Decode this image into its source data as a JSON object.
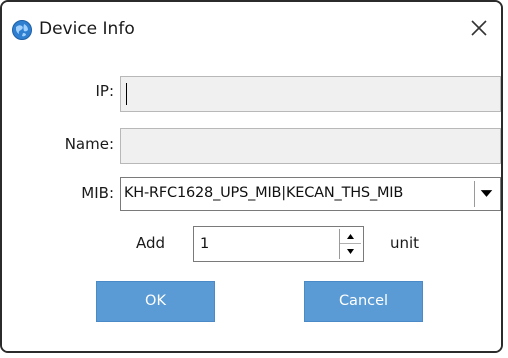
{
  "window": {
    "title": "Device Info",
    "app_icon": "app-globe-icon",
    "close_icon": "close-icon"
  },
  "form": {
    "ip": {
      "label": "IP:",
      "value": ""
    },
    "name": {
      "label": "Name:",
      "value": ""
    },
    "mib": {
      "label": "MIB:",
      "selected": "KH-RFC1628_UPS_MIB|KECAN_THS_MIB",
      "dropdown_icon": "triangle-down-icon"
    },
    "add": {
      "label": "Add",
      "value": "1",
      "unit_label": "unit",
      "up_icon": "spin-up-icon",
      "down_icon": "spin-down-icon"
    }
  },
  "buttons": {
    "ok": "OK",
    "cancel": "Cancel"
  },
  "colors": {
    "button_bg": "#5b9bd5",
    "field_bg": "#f0f0f0",
    "window_border": "#2b2b2b"
  }
}
